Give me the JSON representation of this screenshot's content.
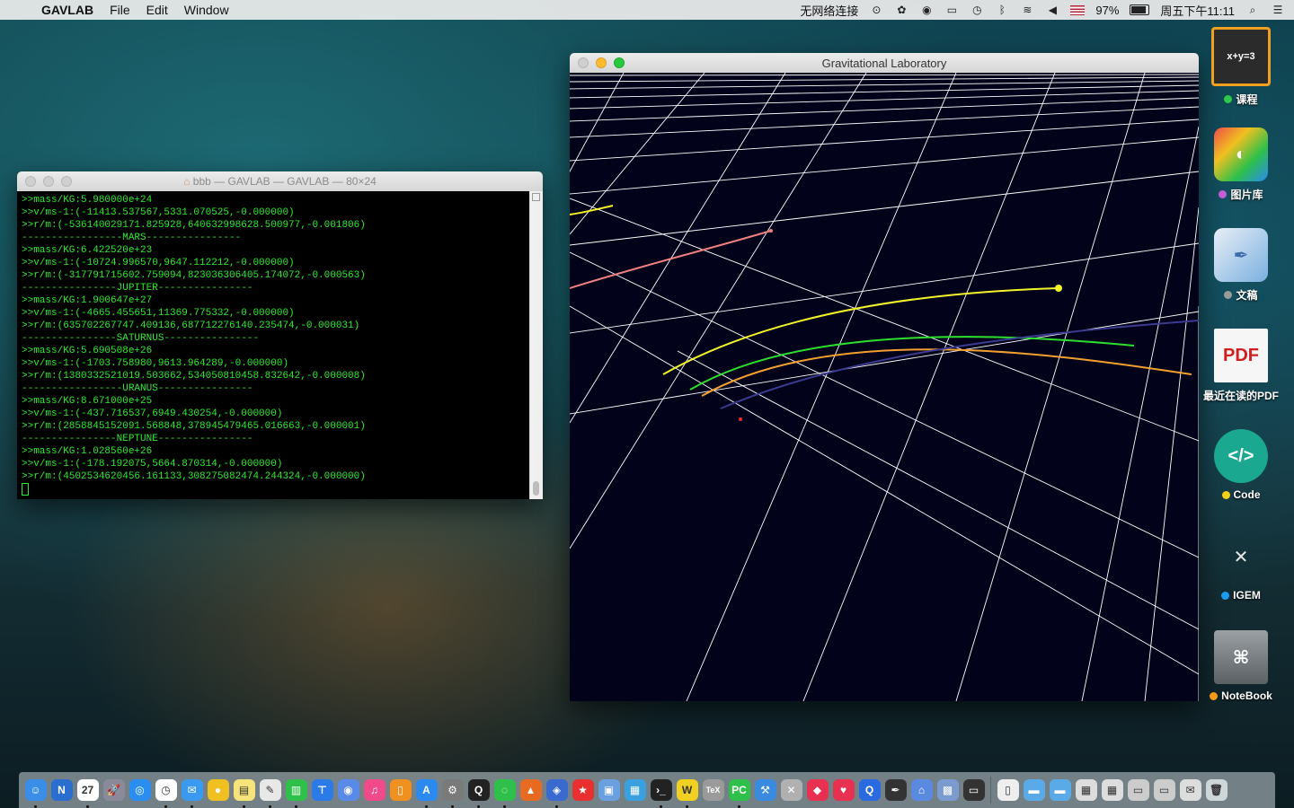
{
  "menubar": {
    "apple_icon": "apple-icon",
    "app_name": "GAVLAB",
    "menus": [
      "File",
      "Edit",
      "Window"
    ],
    "status": {
      "network": "无网络连接",
      "battery": "97%",
      "clock": "周五下午11:11"
    }
  },
  "terminal": {
    "title": "bbb — GAVLAB — GAVLAB — 80×24",
    "lines": [
      ">>mass/KG:5.980000e+24",
      ">>v/ms-1:(-11413.537567,5331.070525,-0.000000)",
      ">>r/m:(-536140029171.825928,640632998628.500977,-0.001806)",
      "-----------------MARS----------------",
      ">>mass/KG:6.422520e+23",
      ">>v/ms-1:(-10724.996570,9647.112212,-0.000000)",
      ">>r/m:(-317791715602.759094,823036306405.174072,-0.000563)",
      "----------------JUPITER----------------",
      ">>mass/KG:1.900647e+27",
      ">>v/ms-1:(-4665.455651,11369.775332,-0.000000)",
      ">>r/m:(635702267747.409136,687712276140.235474,-0.000031)",
      "----------------SATURNUS----------------",
      ">>mass/KG:5.690508e+26",
      ">>v/ms-1:(-1703.758980,9613.964289,-0.000000)",
      ">>r/m:(1380332521019.503662,534050810458.832642,-0.000008)",
      "-----------------URANUS----------------",
      ">>mass/KG:8.671000e+25",
      ">>v/ms-1:(-437.716537,6949.430254,-0.000000)",
      ">>r/m:(2858845152091.568848,378945479465.016663,-0.000001)",
      "----------------NEPTUNE----------------",
      ">>mass/KG:1.028560e+26",
      ">>v/ms-1:(-178.192075,5664.870314,-0.000000)",
      ">>r/m:(4502534620456.161133,308275082474.244324,-0.000000)"
    ]
  },
  "gravity_window": {
    "title": "Gravitational Laboratory",
    "colors": {
      "background": "#02021a",
      "grid": "#ffffff",
      "yellow_orbit": "#f4f42a",
      "green_orbit": "#2ee02e",
      "orange_orbit": "#f4a030",
      "navy_orbit": "#3b3b90",
      "pink_orbit": "#f08080"
    }
  },
  "desktop_icons": [
    {
      "name": "course-icon",
      "label": "课程",
      "tag_color": "#2ec94a"
    },
    {
      "name": "photo-library-icon",
      "label": "图片库",
      "tag_color": "#c45ed6"
    },
    {
      "name": "documents-icon",
      "label": "文稿",
      "tag_color": "#9a9a9a"
    },
    {
      "name": "pdf-icon",
      "label": "最近在读的PDF",
      "tag_color": ""
    },
    {
      "name": "code-folder-icon",
      "label": "Code",
      "tag_color": "#f4cf1a"
    },
    {
      "name": "igem-icon",
      "label": "IGEM",
      "tag_color": "#1a9cf0"
    },
    {
      "name": "notebook-folder-icon",
      "label": "NoteBook",
      "tag_color": "#f49a1a"
    }
  ],
  "dock": {
    "calendar_day": "27",
    "items": [
      {
        "name": "finder-icon",
        "color": "#3a8ee8",
        "glyph": "☺"
      },
      {
        "name": "notes-n-icon",
        "color": "#2a6fd0",
        "glyph": "N"
      },
      {
        "name": "calendar-icon",
        "color": "#ffffff",
        "glyph": "27"
      },
      {
        "name": "launchpad-icon",
        "color": "#8a8a9a",
        "glyph": "🚀"
      },
      {
        "name": "safari-icon",
        "color": "#2a8ef0",
        "glyph": "◎"
      },
      {
        "name": "clock-icon",
        "color": "#ffffff",
        "glyph": "◷"
      },
      {
        "name": "mail-icon",
        "color": "#3a9af0",
        "glyph": "✉"
      },
      {
        "name": "chrome-icon",
        "color": "#f0c020",
        "glyph": "●"
      },
      {
        "name": "stickies-icon",
        "color": "#f6e37a",
        "glyph": "▤"
      },
      {
        "name": "textedit-icon",
        "color": "#e8e8e8",
        "glyph": "✎"
      },
      {
        "name": "numbers-icon",
        "color": "#2ec04a",
        "glyph": "▥"
      },
      {
        "name": "keynote-icon",
        "color": "#2a7ae8",
        "glyph": "⊤"
      },
      {
        "name": "dvd-icon",
        "color": "#5a8ae8",
        "glyph": "◉"
      },
      {
        "name": "itunes-icon",
        "color": "#f04a8a",
        "glyph": "♫"
      },
      {
        "name": "ibooks-icon",
        "color": "#f09020",
        "glyph": "▯"
      },
      {
        "name": "appstore-icon",
        "color": "#2a8af0",
        "glyph": "A"
      },
      {
        "name": "system-preferences-icon",
        "color": "#7a7a7a",
        "glyph": "⚙"
      },
      {
        "name": "qq-icon",
        "color": "#222222",
        "glyph": "Q"
      },
      {
        "name": "wechat-icon",
        "color": "#2ec04a",
        "glyph": "◌"
      },
      {
        "name": "matlab-icon",
        "color": "#e86a20",
        "glyph": "▲"
      },
      {
        "name": "xcode-simulator-icon",
        "color": "#3a6ad0",
        "glyph": "◈"
      },
      {
        "name": "bookmark-icon",
        "color": "#e83030",
        "glyph": "★"
      },
      {
        "name": "preview-icon",
        "color": "#6aa0e0",
        "glyph": "▣"
      },
      {
        "name": "remote-desktop-icon",
        "color": "#3aa0e0",
        "glyph": "▦"
      },
      {
        "name": "terminal-icon",
        "color": "#222222",
        "glyph": "›_"
      },
      {
        "name": "wunderlist-icon",
        "color": "#f0d020",
        "glyph": "W"
      },
      {
        "name": "tex-icon",
        "color": "#9a9a9a",
        "glyph": "TeX"
      },
      {
        "name": "pycharm-icon",
        "color": "#2ec04a",
        "glyph": "PC"
      },
      {
        "name": "xcode-icon",
        "color": "#3a8ae0",
        "glyph": "⚒"
      },
      {
        "name": "archive-icon",
        "color": "#b0b0b0",
        "glyph": "✕"
      },
      {
        "name": "drop-icon",
        "color": "#e83050",
        "glyph": "◆"
      },
      {
        "name": "pocket-icon",
        "color": "#e83050",
        "glyph": "♥"
      },
      {
        "name": "qiyu-icon",
        "color": "#2a6ae0",
        "glyph": "Q"
      },
      {
        "name": "pen-icon",
        "color": "#333333",
        "glyph": "✒"
      },
      {
        "name": "network-icon",
        "color": "#5a8ae0",
        "glyph": "⌂"
      },
      {
        "name": "photos-scan-icon",
        "color": "#7a9ad0",
        "glyph": "▩"
      },
      {
        "name": "console-icon",
        "color": "#333333",
        "glyph": "▭"
      },
      {
        "name": "document-icon",
        "color": "#eeeeee",
        "glyph": "▯"
      },
      {
        "name": "folder-applications-icon",
        "color": "#5aaae8",
        "glyph": "▬"
      },
      {
        "name": "folder-downloads-icon",
        "color": "#5aaae8",
        "glyph": "▬"
      },
      {
        "name": "grid-stack-icon",
        "color": "#dddddd",
        "glyph": "▦"
      },
      {
        "name": "grid-stack-2-icon",
        "color": "#dddddd",
        "glyph": "▦"
      },
      {
        "name": "screenshot-stack-icon",
        "color": "#cccccc",
        "glyph": "▭"
      },
      {
        "name": "screenshot-stack-2-icon",
        "color": "#cccccc",
        "glyph": "▭"
      },
      {
        "name": "mail-stack-icon",
        "color": "#dddddd",
        "glyph": "✉"
      },
      {
        "name": "trash-icon",
        "color": "#cfd6da",
        "glyph": "🗑"
      }
    ]
  }
}
